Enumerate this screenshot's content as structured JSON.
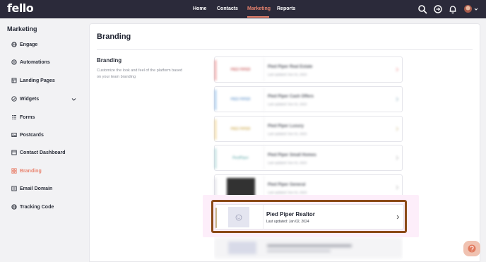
{
  "app": {
    "logo_text": "fello"
  },
  "topnav": {
    "items": [
      {
        "label": "Home"
      },
      {
        "label": "Contacts"
      },
      {
        "label": "Marketing"
      },
      {
        "label": "Reports"
      }
    ],
    "active": "Marketing",
    "icons": [
      "search-icon",
      "compass-icon",
      "bell-icon",
      "avatar"
    ]
  },
  "sidebar": {
    "title": "Marketing",
    "items": [
      {
        "label": "Engage",
        "icon": "globe-icon"
      },
      {
        "label": "Automations",
        "icon": "automation-icon"
      },
      {
        "label": "Landing Pages",
        "icon": "landing-pages-icon"
      },
      {
        "label": "Widgets",
        "icon": "widget-icon"
      },
      {
        "label": "Forms",
        "icon": "forms-icon"
      },
      {
        "label": "Postcards",
        "icon": "postcard-icon"
      },
      {
        "label": "Contact Dashboard",
        "icon": "dashboard-icon"
      },
      {
        "label": "Branding",
        "icon": "branding-icon",
        "active": true
      },
      {
        "label": "Email Domain",
        "icon": "email-domain-icon"
      },
      {
        "label": "Tracking Code",
        "icon": "tracking-icon"
      }
    ]
  },
  "main": {
    "page_title": "Branding",
    "section": {
      "title": "Branding",
      "description": "Customize the look and feel of the platform based on your team branding"
    },
    "brandings": [
      {
        "name": "Pied Piper Real Estate",
        "updated": "Last updated: Nov 01, 2023",
        "accent": "#e56b6b",
        "logo_text": "PIED PIPER",
        "blurred": true
      },
      {
        "name": "Pied Piper Cash Offers",
        "updated": "Last updated: Nov 01, 2023",
        "accent": "#6fa8e0",
        "logo_text": "PIED PIPER",
        "blurred": true
      },
      {
        "name": "Pied Piper Luxury",
        "updated": "Last updated: Nov 01, 2023",
        "accent": "#e8c46a",
        "logo_text": "PIED PIPER",
        "blurred": true
      },
      {
        "name": "Pied Piper Small Homes",
        "updated": "Last updated: Nov 01, 2023",
        "accent": "#8ec8c8",
        "logo_text": "PiedPiper",
        "blurred": true
      },
      {
        "name": "Pied Piper General",
        "updated": "Last updated: Nov 01, 2023",
        "accent": "#cfd0d8",
        "logo_text": "",
        "blurred": true
      },
      {
        "name": "Pied Piper Realtor",
        "updated": "Last updated: Jan 02, 2024",
        "accent": "#c9b48a",
        "logo_text": "",
        "blurred": false
      }
    ]
  }
}
